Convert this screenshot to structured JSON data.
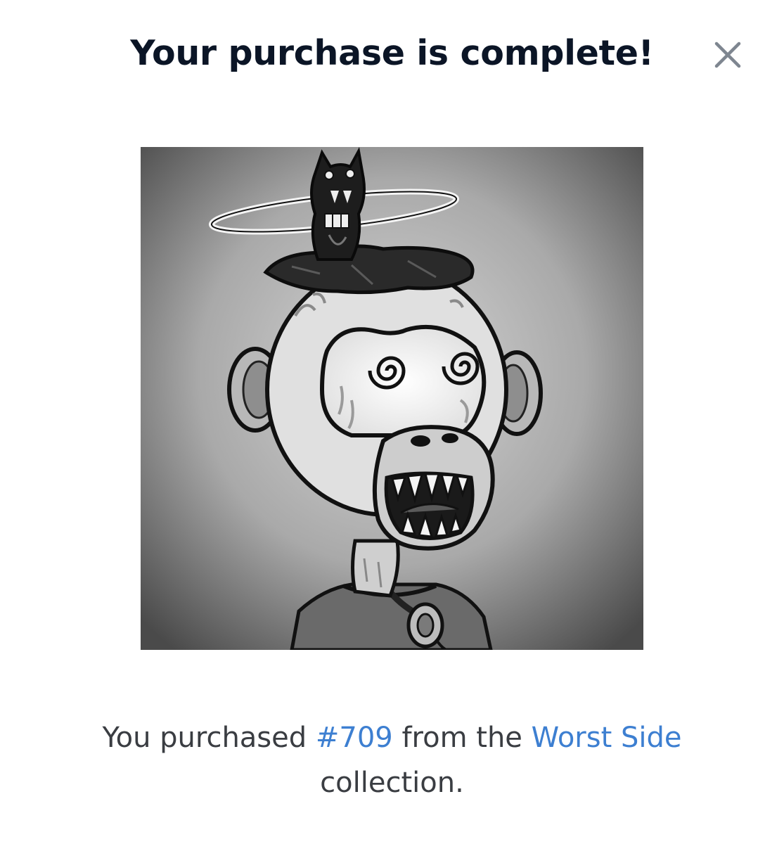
{
  "modal": {
    "title": "Your purchase is complete!",
    "close_icon": "close-icon",
    "close_color": "#7e8690"
  },
  "nft": {
    "image_alt": "Worst Side #709 artwork",
    "style": "grayscale illustration"
  },
  "message": {
    "prefix": "You purchased ",
    "token_id": "#709",
    "middle": " from the ",
    "collection_name": "Worst Side",
    "suffix": " collection.",
    "link_color": "#3d7fd1"
  }
}
